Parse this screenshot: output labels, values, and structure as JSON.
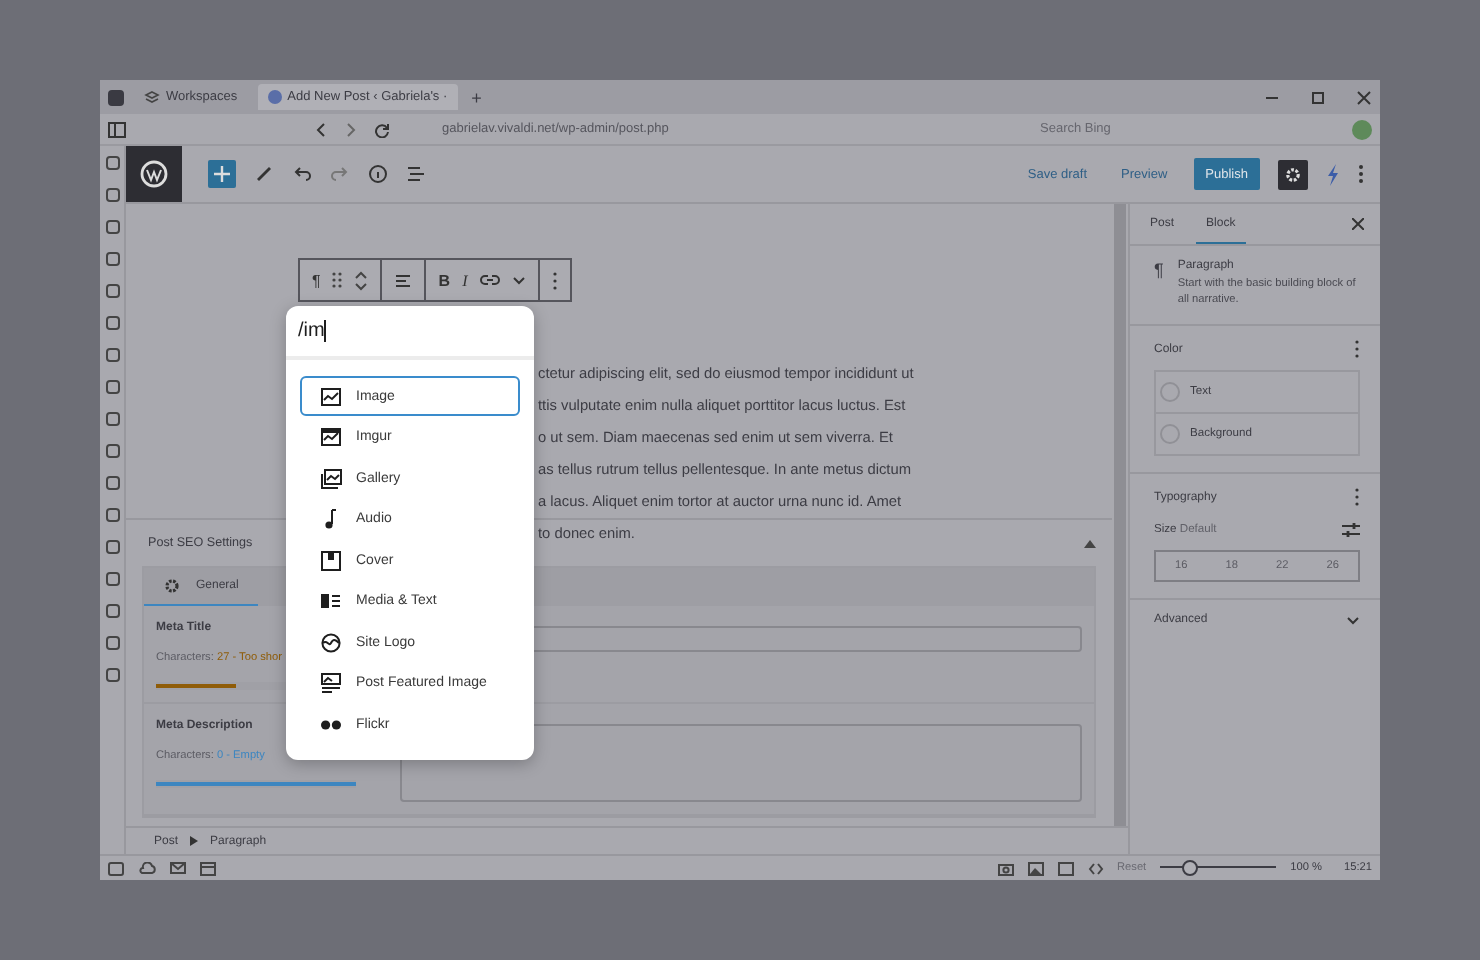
{
  "browser": {
    "tabs": [
      {
        "label": "Workspaces",
        "selected": false
      },
      {
        "label": "Add New Post ‹ Gabriela's ·",
        "selected": true
      }
    ],
    "new_tab": "+",
    "address": "gabrielav.vivaldi.net/wp-admin/post.php",
    "search": {
      "placeholder": "Search Bing"
    }
  },
  "wp_toolbar": {
    "buttons": [
      {
        "label": "Save draft",
        "kind": "link"
      },
      {
        "label": "Preview",
        "kind": "link"
      },
      {
        "label": "Publish",
        "kind": "primary"
      }
    ]
  },
  "block_toolbar": {
    "paragraph": "¶",
    "bold": "B",
    "italic": "I"
  },
  "paragraph_lines": [
    "ctetur adipiscing elit, sed do eiusmod tempor incididunt ut",
    "ttis vulputate enim nulla aliquet porttitor lacus luctus. Est",
    "o ut sem. Diam maecenas sed enim ut sem viverra. Et",
    "as tellus rutrum tellus pellentesque. In ante metus dictum",
    "a lacus. Aliquet enim tortor at auctor urna nunc id. Amet",
    "to donec enim."
  ],
  "inserter": {
    "query": "/im",
    "items": [
      {
        "label": "Image",
        "selected": true
      },
      {
        "label": "Imgur",
        "selected": false
      },
      {
        "label": "Gallery",
        "selected": false
      },
      {
        "label": "Audio",
        "selected": false
      },
      {
        "label": "Cover",
        "selected": false
      },
      {
        "label": "Media & Text",
        "selected": false
      },
      {
        "label": "Site Logo",
        "selected": false
      },
      {
        "label": "Post Featured Image",
        "selected": false
      },
      {
        "label": "Flickr",
        "selected": false
      }
    ]
  },
  "seo": {
    "title": "Post SEO Settings",
    "tabs": [
      {
        "label": "General",
        "selected": true
      }
    ],
    "fields": [
      {
        "label": "Meta Title",
        "count_label": "Characters:",
        "count": "27 - Too shor",
        "color": "#8f5c08",
        "level": 0.4,
        "kind": "line"
      },
      {
        "label": "Meta Description",
        "count_label": "Characters:",
        "count": "0 - Empty",
        "color": "#3d86c0",
        "level": 1,
        "kind": "area"
      }
    ]
  },
  "sidebar": {
    "tabs": [
      {
        "label": "Post",
        "selected": false
      },
      {
        "label": "Block",
        "selected": true
      }
    ],
    "block": {
      "icon": "¶",
      "name": "Paragraph",
      "description": "Start with the basic building block of all narrative."
    },
    "color": {
      "title": "Color",
      "items": [
        "Text",
        "Background"
      ]
    },
    "typography": {
      "title": "Typography",
      "size_label": "Size",
      "size_value": "Default",
      "sizes": [
        "16",
        "18",
        "22",
        "26"
      ]
    },
    "advanced": {
      "title": "Advanced",
      "expanded": false
    }
  },
  "breadcrumb": [
    "Post",
    "Paragraph"
  ],
  "status": {
    "reset": "Reset",
    "zoom_level": {
      "level": 0.25
    },
    "zoom": "100 %",
    "time": "15:21"
  }
}
